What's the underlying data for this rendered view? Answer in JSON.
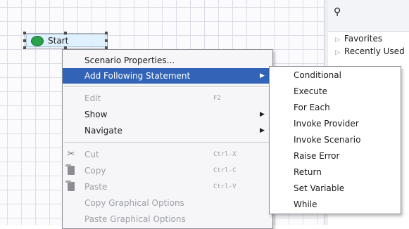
{
  "node": {
    "label": "Start"
  },
  "palette": {
    "search_icon": "binoculars-icon",
    "items": [
      {
        "label": "Favorites"
      },
      {
        "label": "Recently Used"
      }
    ]
  },
  "context_menu": {
    "items": [
      {
        "label": "Scenario Properties...",
        "accelerator": "",
        "enabled": true
      },
      {
        "label": "Add Following Statement",
        "accelerator": "",
        "enabled": true,
        "highlighted": true,
        "submenu": true
      },
      {
        "label": "Edit",
        "accelerator": "F2",
        "enabled": false
      },
      {
        "label": "Show",
        "accelerator": "",
        "enabled": true,
        "submenu": true
      },
      {
        "label": "Navigate",
        "accelerator": "",
        "enabled": true,
        "submenu": true
      },
      {
        "label": "Cut",
        "accelerator": "Ctrl-X",
        "enabled": false,
        "icon": "scissors-icon"
      },
      {
        "label": "Copy",
        "accelerator": "Ctrl-C",
        "enabled": false,
        "icon": "copy-icon"
      },
      {
        "label": "Paste",
        "accelerator": "Ctrl-V",
        "enabled": false,
        "icon": "paste-icon"
      },
      {
        "label": "Copy Graphical Options",
        "accelerator": "",
        "enabled": false
      },
      {
        "label": "Paste Graphical Options",
        "accelerator": "",
        "enabled": false
      }
    ]
  },
  "submenu": {
    "items": [
      {
        "label": "Conditional"
      },
      {
        "label": "Execute"
      },
      {
        "label": "For Each"
      },
      {
        "label": "Invoke Provider"
      },
      {
        "label": "Invoke Scenario"
      },
      {
        "label": "Raise Error"
      },
      {
        "label": "Return"
      },
      {
        "label": "Set Variable"
      },
      {
        "label": "While"
      }
    ]
  },
  "colors": {
    "highlight": "#3163b6",
    "node_fill": "#dff0ff",
    "node_circle": "#2aa24a"
  }
}
